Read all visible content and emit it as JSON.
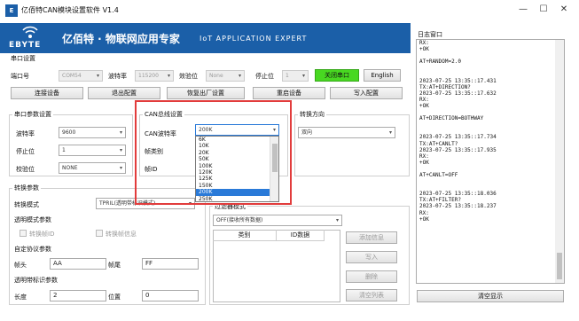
{
  "window": {
    "title": "亿佰特CAN模块设置软件 V1.4",
    "icon_text": "E"
  },
  "banner": {
    "brand": "EBYTE",
    "slogan_cn": "亿佰特 · 物联网应用专家",
    "slogan_en": "IoT APPLICATION EXPERT"
  },
  "serial_setup": {
    "title": "串口设置",
    "port_label": "端口号",
    "port_value": "COM54",
    "baud_label": "波特率",
    "baud_value": "115200",
    "parity_label": "效验位",
    "parity_value": "None",
    "stop_label": "停止位",
    "stop_value": "1",
    "close_button": "关闭串口",
    "english_button": "English",
    "connect_button": "连接设备",
    "exit_button": "退出配置",
    "factory_button": "恢复出厂设置",
    "restart_button": "重启设备",
    "write_button": "写入配置"
  },
  "serial_params": {
    "title": "串口参数设置",
    "baud_label": "波特率",
    "baud_value": "9600",
    "stop_label": "停止位",
    "stop_value": "1",
    "parity_label": "校验位",
    "parity_value": "NONE"
  },
  "can_params": {
    "title": "CAN总线设置",
    "baud_label": "CAN波特率",
    "baud_value": "200K",
    "frame_type_label": "帧类别",
    "frame_id_label": "帧ID",
    "options": [
      "6K",
      "10K",
      "20K",
      "50K",
      "100K",
      "120K",
      "125K",
      "150K",
      "200K",
      "250K"
    ],
    "selected_index": 8
  },
  "direction": {
    "title": "转换方向",
    "value": "双向"
  },
  "convert": {
    "title": "转换参数",
    "mode_label": "转换模式",
    "mode_value": "TPRIL(透明带标识模式)",
    "transparent_title": "透明模式参数",
    "transparent_cb1": "转换帧ID",
    "transparent_cb2": "转换帧信息",
    "custom_title": "自定协议参数",
    "head_label": "帧头",
    "head_value": "AA",
    "tail_label": "帧尾",
    "tail_value": "FF",
    "tag_title": "透明带标识参数",
    "length_label": "长度",
    "length_value": "2",
    "position_label": "位置",
    "position_value": "0"
  },
  "filter": {
    "title": "过滤器模式",
    "mode_value": "OFF(接收所有数据)",
    "col_type": "类别",
    "col_id": "ID数据",
    "add_button": "添加信息",
    "write_button": "写入",
    "delete_button": "删除",
    "clear_button": "清空列表"
  },
  "log": {
    "title": "日志窗口",
    "lines": [
      "RX:",
      "+OK",
      "",
      "AT+RANDOM=2.0",
      "",
      "",
      "2023-07-25 13:35::17.431",
      "TX:AT+DIRECTION?",
      "2023-07-25 13:35::17.632",
      "RX:",
      "+OK",
      "",
      "AT+DIRECTION=BOTHWAY",
      "",
      "",
      "2023-07-25 13:35::17.734",
      "TX:AT+CANLT?",
      "2023-07-25 13:35::17.935",
      "RX:",
      "+OK",
      "",
      "AT+CANLT=OFF",
      "",
      "",
      "2023-07-25 13:35::18.036",
      "TX:AT+FILTER?",
      "2023-07-25 13:35::18.237",
      "RX:",
      "+OK"
    ],
    "clear_button": "清空显示"
  },
  "colors": {
    "banner": "#1b5fa8",
    "green": "#48d821",
    "highlight": "#e23c3c",
    "selected": "#2a7ad8"
  }
}
